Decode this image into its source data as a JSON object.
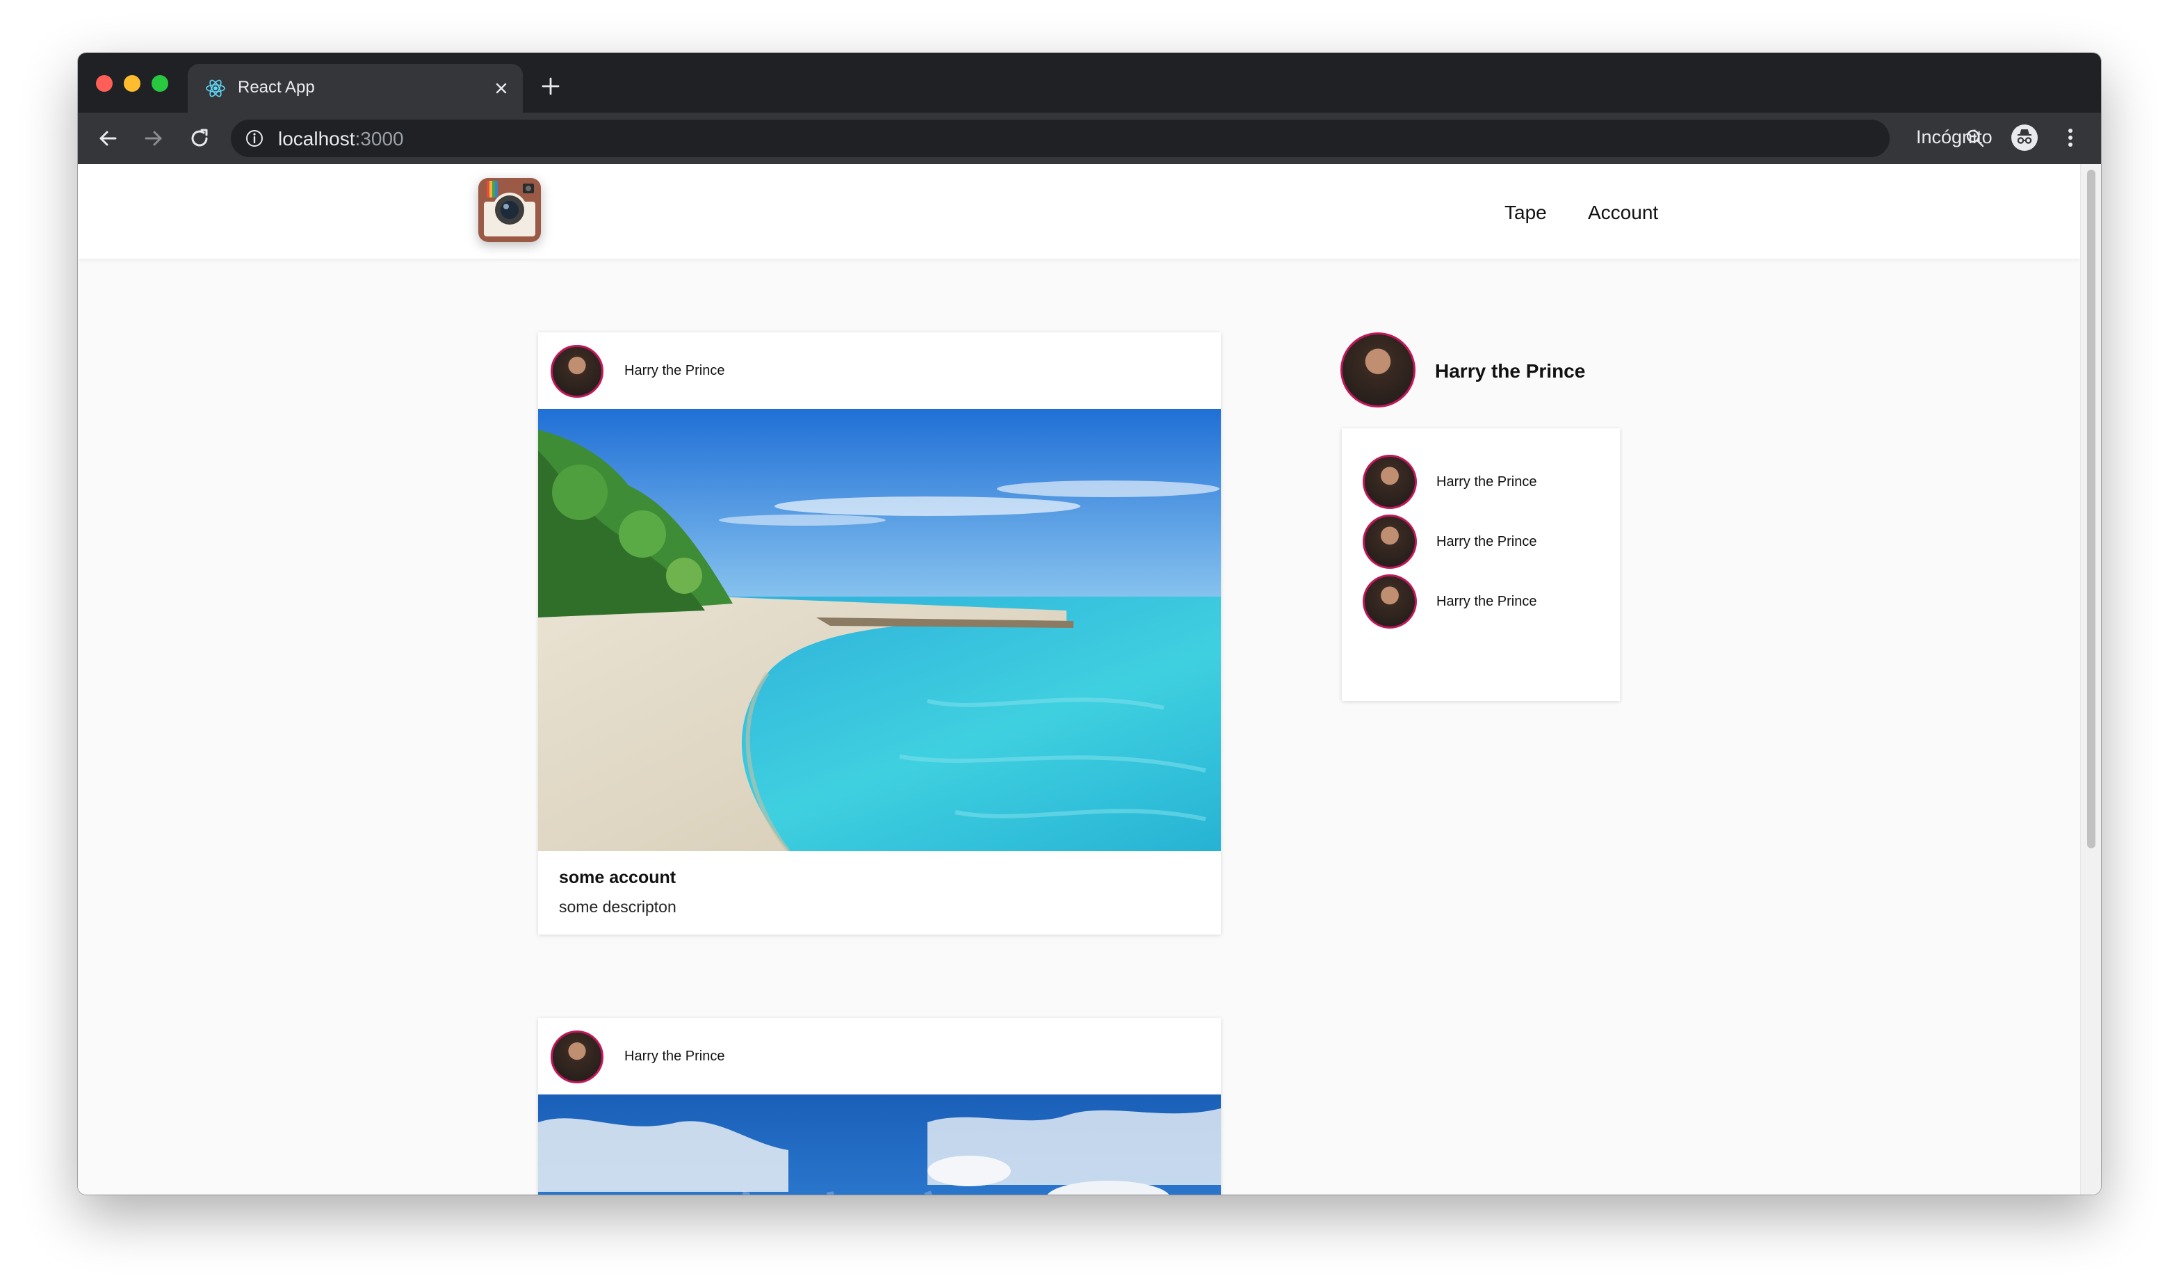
{
  "browser": {
    "tab_title": "React App",
    "url_host": "localhost",
    "url_port": ":3000",
    "incognito_label": "Incógnito"
  },
  "header": {
    "nav": [
      "Tape",
      "Account"
    ]
  },
  "feed": [
    {
      "username": "Harry the Prince",
      "title": "some account",
      "description": "some descripton",
      "image": "beach"
    },
    {
      "username": "Harry the Prince",
      "image": "sky"
    }
  ],
  "sidebar": {
    "profile_name": "Harry the Prince",
    "suggestions": [
      "Harry the Prince",
      "Harry the Prince",
      "Harry the Prince"
    ]
  },
  "colors": {
    "avatar_ring": "#c2185b",
    "browser_dark": "#202124",
    "toolbar": "#35363a",
    "page_bg": "#fafafa"
  }
}
